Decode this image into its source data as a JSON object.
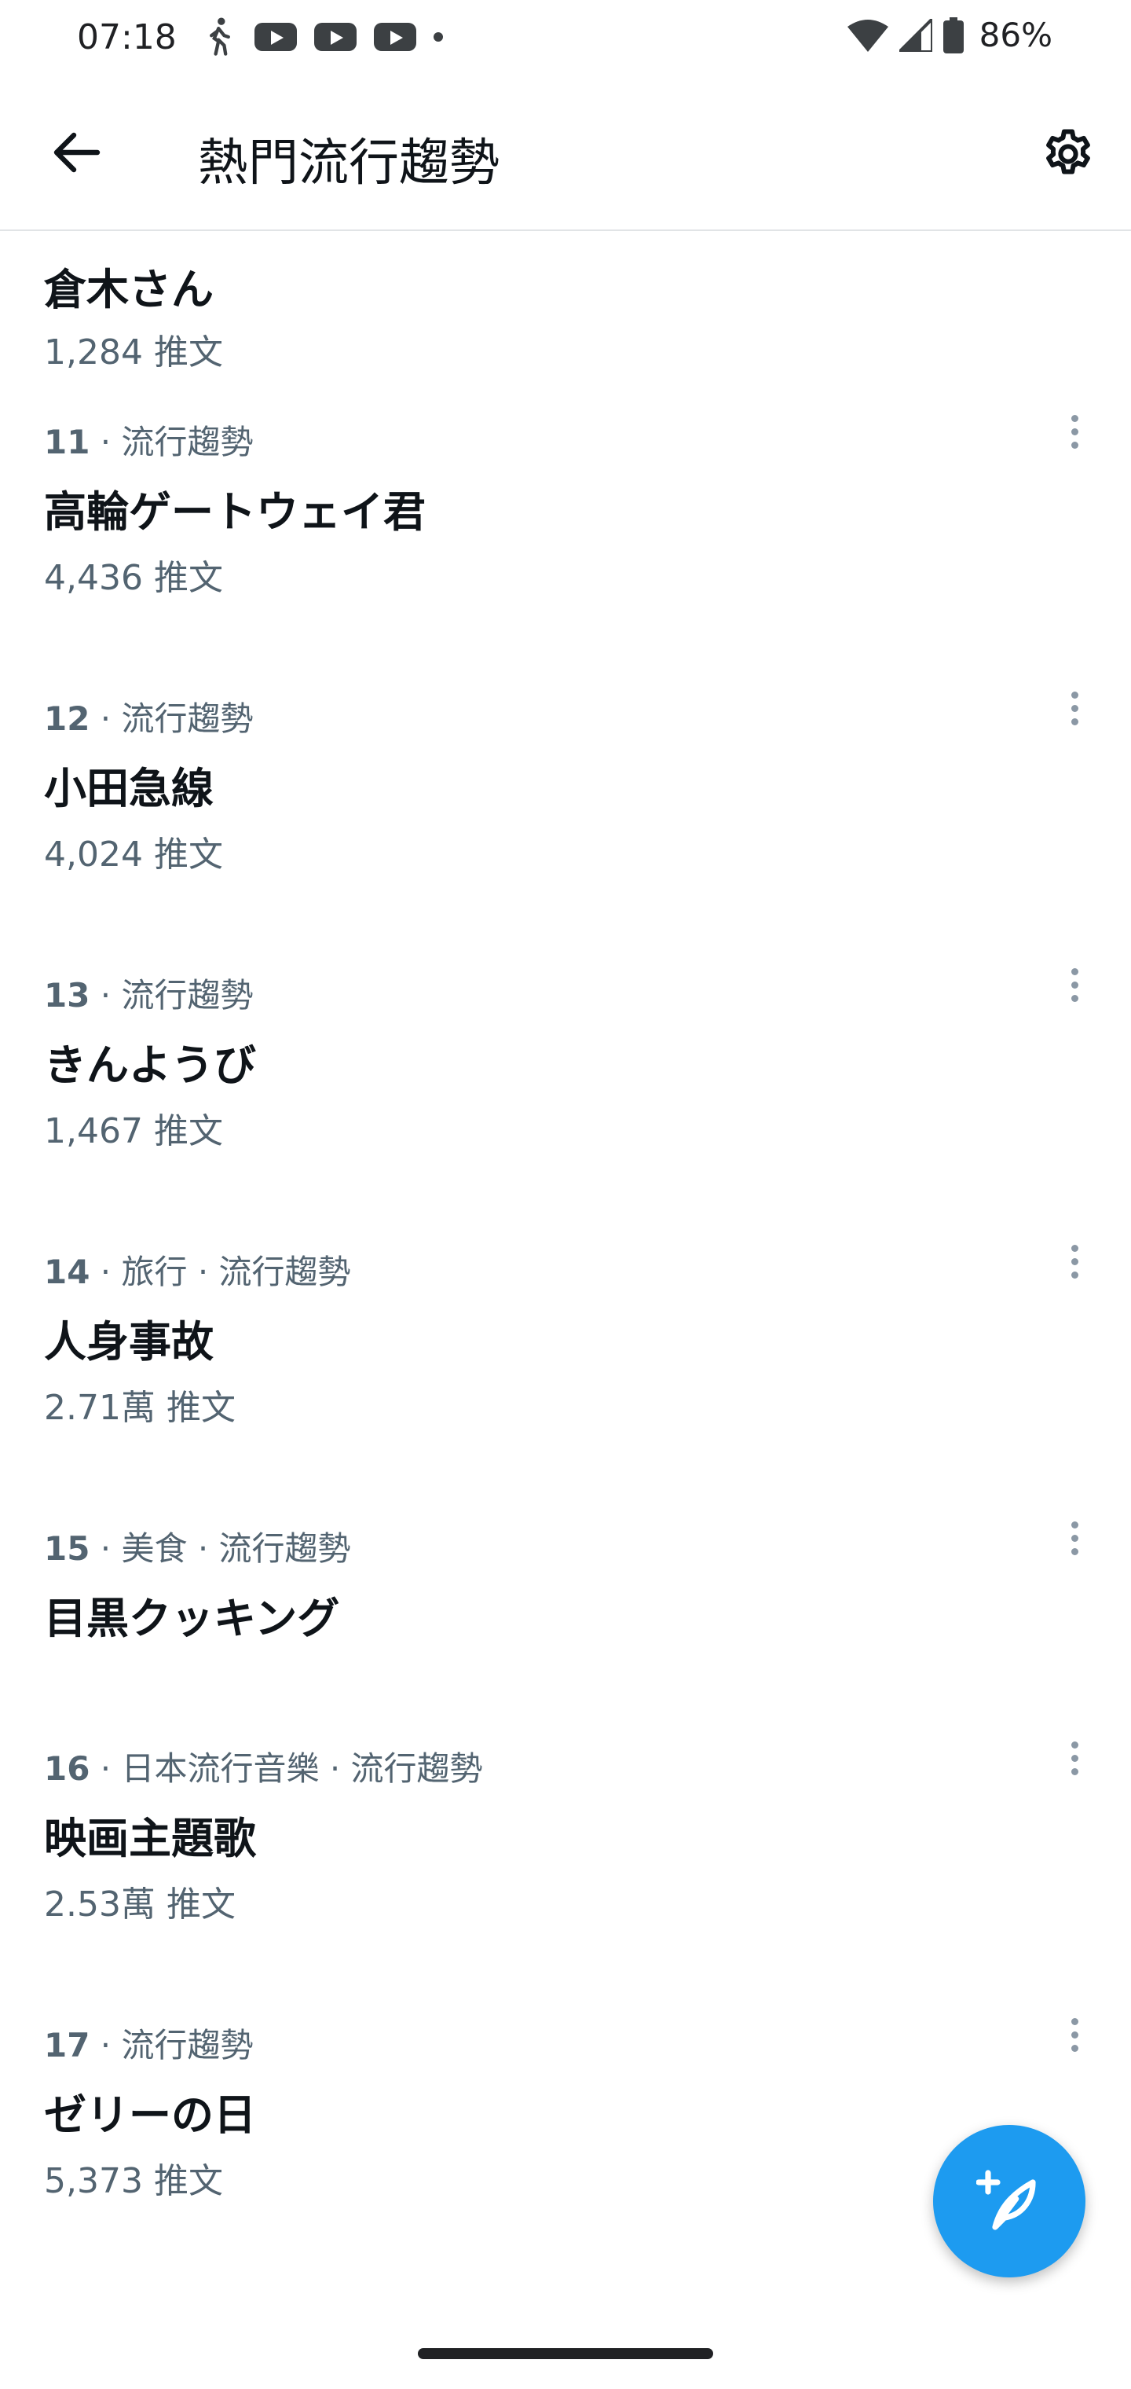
{
  "status_bar": {
    "time": "07:18",
    "battery": "86%",
    "icons": [
      "walking-icon",
      "youtube-icon",
      "youtube-icon",
      "youtube-icon",
      "dot-icon",
      "wifi-icon",
      "signal-icon",
      "battery-icon"
    ]
  },
  "app_bar": {
    "title": "熱門流行趨勢",
    "back_icon": "arrow-left-icon",
    "settings_icon": "gear-icon"
  },
  "trends": [
    {
      "meta": "",
      "name": "倉木さん",
      "count": "1,284 推文"
    },
    {
      "rank": "11",
      "meta": " · 流行趨勢",
      "name": "高輪ゲートウェイ君",
      "count": "4,436 推文"
    },
    {
      "rank": "12",
      "meta": " · 流行趨勢",
      "name": "小田急線",
      "count": "4,024 推文"
    },
    {
      "rank": "13",
      "meta": " · 流行趨勢",
      "name": "きんようび",
      "count": "1,467 推文"
    },
    {
      "rank": "14",
      "meta": " · 旅行 · 流行趨勢",
      "name": "人身事故",
      "count": "2.71萬 推文"
    },
    {
      "rank": "15",
      "meta": " · 美食 · 流行趨勢",
      "name": "目黒クッキング",
      "count": ""
    },
    {
      "rank": "16",
      "meta": " · 日本流行音樂 · 流行趨勢",
      "name": "映画主題歌",
      "count": "2.53萬 推文"
    },
    {
      "rank": "17",
      "meta": " · 流行趨勢",
      "name": "ゼリーの日",
      "count": "5,373 推文"
    }
  ],
  "fab": {
    "icon": "compose-tweet-icon"
  },
  "colors": {
    "accent": "#1d9bf0",
    "secondary_text": "#536471",
    "primary_text": "#0f1419"
  }
}
